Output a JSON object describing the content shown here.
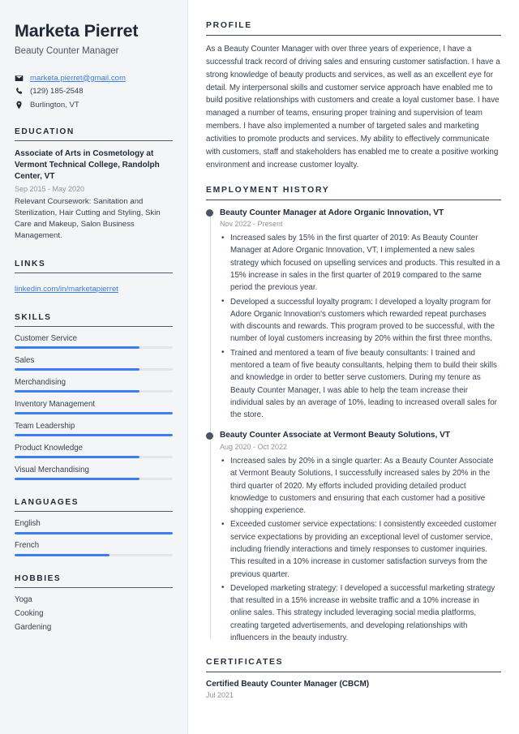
{
  "sidebar": {
    "name": "Marketa Pierret",
    "job_title": "Beauty Counter Manager",
    "contacts": [
      {
        "icon": "envelope-icon",
        "text": "marketa.pierret@gmail.com",
        "is_link": true
      },
      {
        "icon": "phone-icon",
        "text": "(129) 185-2548",
        "is_link": false
      },
      {
        "icon": "map-pin-icon",
        "text": "Burlington, VT",
        "is_link": false
      }
    ],
    "education": {
      "heading": "EDUCATION",
      "degree": "Associate of Arts in Cosmetology at Vermont Technical College, Randolph Center, VT",
      "date": "Sep 2015 - May 2020",
      "description": "Relevant Coursework: Sanitation and Sterilization, Hair Cutting and Styling, Skin Care and Makeup, Salon Business Management."
    },
    "links": {
      "heading": "LINKS",
      "items": [
        {
          "label": "linkedin.com/in/marketapierret"
        }
      ]
    },
    "skills": {
      "heading": "SKILLS",
      "items": [
        {
          "label": "Customer Service",
          "level": 79
        },
        {
          "label": "Sales",
          "level": 79
        },
        {
          "label": "Merchandising",
          "level": 79
        },
        {
          "label": "Inventory Management",
          "level": 100
        },
        {
          "label": "Team Leadership",
          "level": 100
        },
        {
          "label": "Product Knowledge",
          "level": 79
        },
        {
          "label": "Visual Merchandising",
          "level": 79
        }
      ]
    },
    "languages": {
      "heading": "LANGUAGES",
      "items": [
        {
          "label": "English",
          "level": 100
        },
        {
          "label": "French",
          "level": 60
        }
      ]
    },
    "hobbies": {
      "heading": "HOBBIES",
      "items": [
        {
          "label": "Yoga"
        },
        {
          "label": "Cooking"
        },
        {
          "label": "Gardening"
        }
      ]
    }
  },
  "main": {
    "profile": {
      "heading": "PROFILE",
      "text": "As a Beauty Counter Manager with over three years of experience, I have a successful track record of driving sales and ensuring customer satisfaction. I have a strong knowledge of beauty products and services, as well as an excellent eye for detail. My interpersonal skills and customer service approach have enabled me to build positive relationships with customers and create a loyal customer base. I have managed a number of teams, ensuring proper training and supervision of team members. I have also implemented a number of targeted sales and marketing activities to promote products and services. My ability to effectively communicate with customers, staff and stakeholders has enabled me to create a positive working environment and increase customer loyalty."
    },
    "employment": {
      "heading": "EMPLOYMENT HISTORY",
      "jobs": [
        {
          "role": "Beauty Counter Manager at Adore Organic Innovation, VT",
          "date": "Nov 2022 - Present",
          "bullets": [
            "Increased sales by 15% in the first quarter of 2019: As Beauty Counter Manager at Adore Organic Innovation, VT, I implemented a new sales strategy which focused on upselling services and products. This resulted in a 15% increase in sales in the first quarter of 2019 compared to the same period the previous year.",
            "Developed a successful loyalty program: I developed a loyalty program for Adore Organic Innovation's customers which rewarded repeat purchases with discounts and rewards. This program proved to be successful, with the number of loyal customers increasing by 20% within the first three months.",
            "Trained and mentored a team of five beauty consultants: I trained and mentored a team of five beauty consultants, helping them to build their skills and knowledge in order to better serve customers. During my tenure as Beauty Counter Manager, I was able to help the team increase their individual sales by an average of 10%, leading to increased overall sales for the store."
          ]
        },
        {
          "role": "Beauty Counter Associate at Vermont Beauty Solutions, VT",
          "date": "Aug 2020 - Oct 2022",
          "bullets": [
            "Increased sales by 20% in a single quarter: As a Beauty Counter Associate at Vermont Beauty Solutions, I successfully increased sales by 20% in the third quarter of 2020. My efforts included providing detailed product knowledge to customers and ensuring that each customer had a positive shopping experience.",
            "Exceeded customer service expectations: I consistently exceeded customer service expectations by providing an exceptional level of customer service, including friendly interactions and timely responses to customer inquiries. This resulted in a 10% increase in customer satisfaction surveys from the previous quarter.",
            "Developed marketing strategy: I developed a successful marketing strategy that resulted in a 15% increase in website traffic and a 10% increase in online sales. This strategy included leveraging social media platforms, creating targeted advertisements, and developing relationships with influencers in the beauty industry."
          ]
        }
      ]
    },
    "certificates": {
      "heading": "CERTIFICATES",
      "items": [
        {
          "name": "Certified Beauty Counter Manager (CBCM)",
          "date": "Jul 2021"
        }
      ]
    }
  },
  "colors": {
    "accent": "#3d7df2",
    "link": "#3b7de0",
    "sidebar_bg": "#f4f5f7",
    "heading": "#1f2937",
    "muted": "#8d93a1"
  }
}
